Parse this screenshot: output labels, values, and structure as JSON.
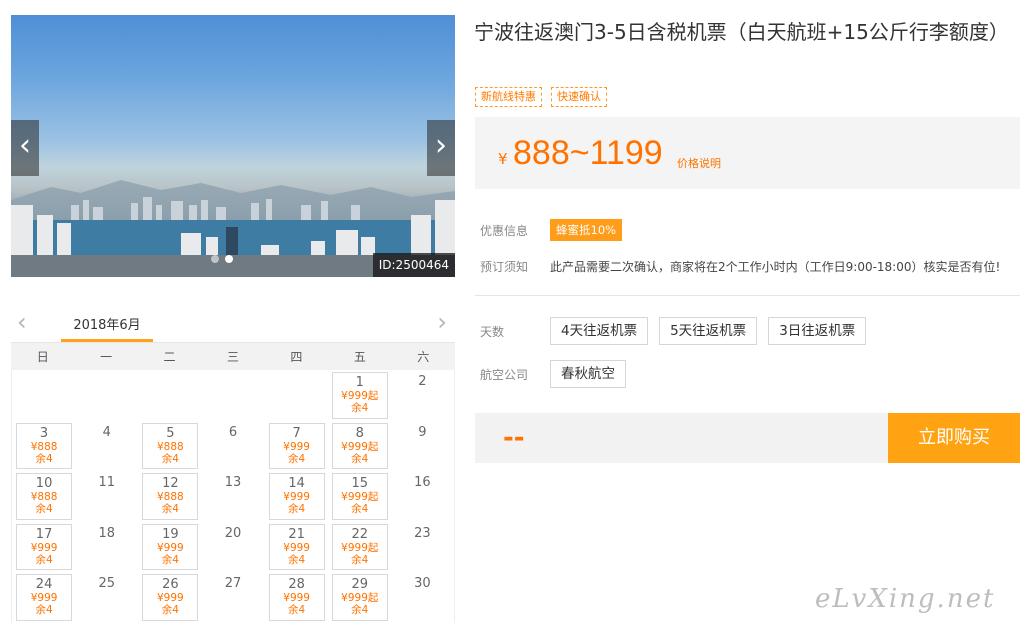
{
  "gallery": {
    "prev_label": "‹",
    "next_label": "›",
    "image_id": "ID:2500464",
    "dot_count": 2,
    "active_dot": 1
  },
  "calendar": {
    "month": "2018年6月",
    "weekdays": [
      "日",
      "一",
      "二",
      "三",
      "四",
      "五",
      "六"
    ],
    "cells": [
      {
        "day": "",
        "price": "",
        "left": ""
      },
      {
        "day": "",
        "price": "",
        "left": ""
      },
      {
        "day": "",
        "price": "",
        "left": ""
      },
      {
        "day": "",
        "price": "",
        "left": ""
      },
      {
        "day": "",
        "price": "",
        "left": ""
      },
      {
        "day": "1",
        "price": "¥999起",
        "left": "余4"
      },
      {
        "day": "2",
        "price": "",
        "left": ""
      },
      {
        "day": "3",
        "price": "¥888",
        "left": "余4"
      },
      {
        "day": "4",
        "price": "",
        "left": ""
      },
      {
        "day": "5",
        "price": "¥888",
        "left": "余4"
      },
      {
        "day": "6",
        "price": "",
        "left": ""
      },
      {
        "day": "7",
        "price": "¥999",
        "left": "余4"
      },
      {
        "day": "8",
        "price": "¥999起",
        "left": "余4"
      },
      {
        "day": "9",
        "price": "",
        "left": ""
      },
      {
        "day": "10",
        "price": "¥888",
        "left": "余4"
      },
      {
        "day": "11",
        "price": "",
        "left": ""
      },
      {
        "day": "12",
        "price": "¥888",
        "left": "余4"
      },
      {
        "day": "13",
        "price": "",
        "left": ""
      },
      {
        "day": "14",
        "price": "¥999",
        "left": "余4"
      },
      {
        "day": "15",
        "price": "¥999起",
        "left": "余4"
      },
      {
        "day": "16",
        "price": "",
        "left": ""
      },
      {
        "day": "17",
        "price": "¥999",
        "left": "余4"
      },
      {
        "day": "18",
        "price": "",
        "left": ""
      },
      {
        "day": "19",
        "price": "¥999",
        "left": "余4"
      },
      {
        "day": "20",
        "price": "",
        "left": ""
      },
      {
        "day": "21",
        "price": "¥999",
        "left": "余4"
      },
      {
        "day": "22",
        "price": "¥999起",
        "left": "余4"
      },
      {
        "day": "23",
        "price": "",
        "left": ""
      },
      {
        "day": "24",
        "price": "¥999",
        "left": "余4"
      },
      {
        "day": "25",
        "price": "",
        "left": ""
      },
      {
        "day": "26",
        "price": "¥999",
        "left": "余4"
      },
      {
        "day": "27",
        "price": "",
        "left": ""
      },
      {
        "day": "28",
        "price": "¥999",
        "left": "余4"
      },
      {
        "day": "29",
        "price": "¥999起",
        "left": "余4"
      },
      {
        "day": "30",
        "price": "",
        "left": ""
      }
    ]
  },
  "product": {
    "title": "宁波往返澳门3-5日含税机票（白天航班+15公斤行李额度）",
    "tags": [
      "新航线特惠",
      "快速确认"
    ],
    "currency": "¥",
    "price_range": "888~1199",
    "price_note": "价格说明"
  },
  "info": {
    "discount_label": "优惠信息",
    "discount_badge": "蜂蜜抵10%",
    "booking_label": "预订须知",
    "booking_text": "此产品需要二次确认，商家将在2个工作小时内（工作日9:00-18:00）核实是否有位!"
  },
  "options": {
    "days_label": "天数",
    "days": [
      "4天往返机票",
      "5天往返机票",
      "3日往返机票"
    ],
    "airline_label": "航空公司",
    "airlines": [
      "春秋航空"
    ]
  },
  "buy": {
    "total_placeholder": "--",
    "button_label": "立即购买"
  },
  "watermark": "eLvXing.net",
  "colors": {
    "accent": "#ff7200",
    "button": "#ffa313",
    "badge": "#ff9c1a"
  }
}
